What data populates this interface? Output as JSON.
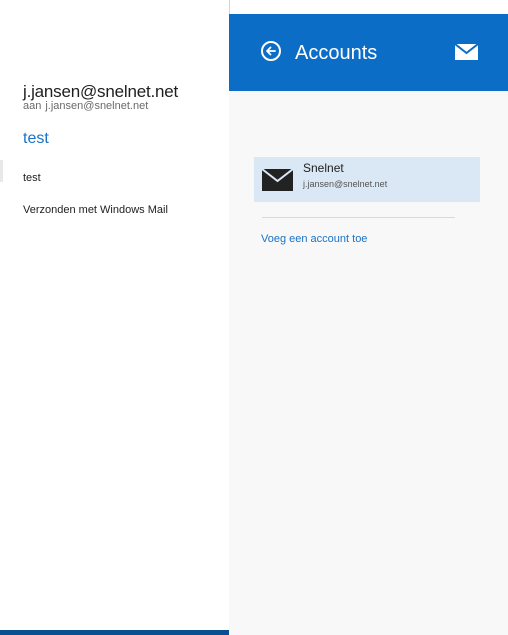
{
  "reading_pane": {
    "sender": "j.jansen@snelnet.net",
    "recipient_prefix": "aan",
    "recipient": "j.jansen@snelnet.net",
    "subject": "test",
    "body_line_1": "test",
    "body_line_2": "Verzonden met Windows Mail"
  },
  "flyout": {
    "title": "Accounts",
    "back_icon": "back-arrow-circle-icon",
    "header_icon": "mail-icon",
    "accounts": [
      {
        "name": "Snelnet",
        "email": "j.jansen@snelnet.net",
        "icon": "mail-icon"
      }
    ],
    "add_account_label": "Voeg een account toe"
  },
  "colors": {
    "accent": "#0c6dc6",
    "link": "#1b72c4",
    "selected_row": "#dae7f4",
    "flyout_bg": "#f8f8f8",
    "bottom_bar": "#0a4f8f"
  }
}
